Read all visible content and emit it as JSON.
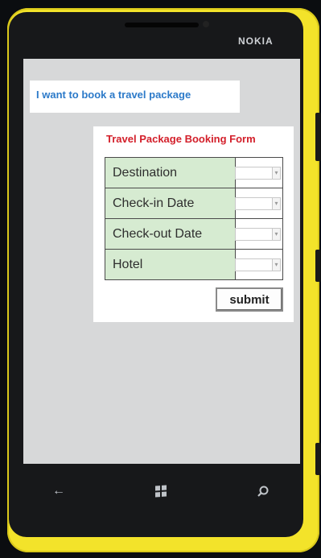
{
  "device": {
    "brand": "NOKIA",
    "shell_color": "#f3e32a",
    "screen_background": "#d7d8d9"
  },
  "chat": {
    "message": "I want to book a travel package",
    "text_color": "#2c7ac9"
  },
  "form": {
    "title": "Travel Package Booking Form",
    "title_color": "#d31f2a",
    "label_background": "#d6ebd1",
    "fields": [
      {
        "label": "Destination",
        "control": "select"
      },
      {
        "label": "Check-in Date",
        "control": "select"
      },
      {
        "label": "Check-out Date",
        "control": "select"
      },
      {
        "label": "Hotel",
        "control": "select"
      }
    ],
    "submit_label": "submit"
  },
  "navbar": {
    "back_icon": "back-arrow-icon",
    "home_icon": "windows-logo-icon",
    "search_icon": "search-icon"
  }
}
